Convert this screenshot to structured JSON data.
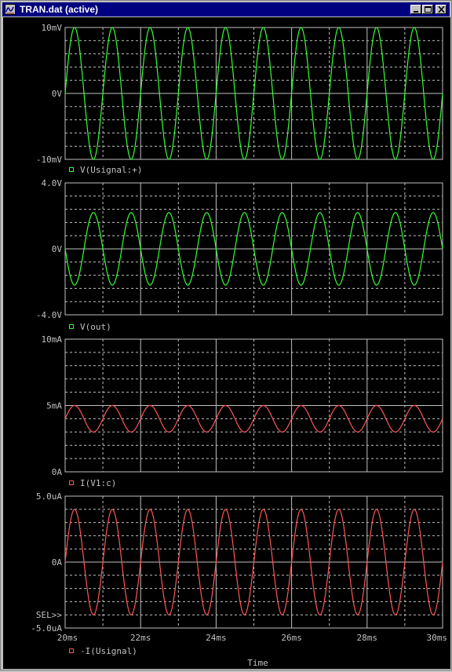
{
  "window": {
    "title": "TRAN.dat (active)",
    "buttons": [
      "minimize",
      "maximize",
      "close"
    ],
    "icon": "probe-window-icon"
  },
  "colors": {
    "background": "#000000",
    "grid": "#c0c0c0",
    "text": "#c0c0c0",
    "green_trace": "#33ff33",
    "red_trace": "#ff5555",
    "titlebar": "#000080"
  },
  "chart_data": [
    {
      "type": "line",
      "x_unit": "ms",
      "xlim": [
        20,
        30
      ],
      "ytick_labels": [
        "10mV",
        "0V",
        "-10mV"
      ],
      "ylim": [
        -10,
        10
      ],
      "y_unit": "mV",
      "grid": true,
      "series": [
        {
          "name": "V(Usignal:+)",
          "color": "#33ff33",
          "waveform": "sine",
          "frequency_khz": 1,
          "amplitude": 10,
          "offset": 0,
          "phase_deg": 0
        }
      ],
      "legend": [
        "V(Usignal:+)"
      ]
    },
    {
      "type": "line",
      "x_unit": "ms",
      "xlim": [
        20,
        30
      ],
      "ytick_labels": [
        "4.0V",
        "0V",
        "-4.0V"
      ],
      "ylim": [
        -4,
        4
      ],
      "y_unit": "V",
      "grid": true,
      "series": [
        {
          "name": "V(out)",
          "color": "#33ff33",
          "waveform": "sine",
          "frequency_khz": 1,
          "amplitude": 2.2,
          "offset": 0,
          "phase_deg": 180
        }
      ],
      "legend": [
        "V(out)"
      ]
    },
    {
      "type": "line",
      "x_unit": "ms",
      "xlim": [
        20,
        30
      ],
      "ytick_labels": [
        "10mA",
        "5mA",
        "0A"
      ],
      "ylim": [
        0,
        10
      ],
      "y_unit": "mA",
      "grid": true,
      "series": [
        {
          "name": "I(V1:c)",
          "color": "#ff5555",
          "waveform": "sine",
          "frequency_khz": 1,
          "amplitude": 1.0,
          "offset": 4.0,
          "phase_deg": 0
        }
      ],
      "legend": [
        "I(V1:c)"
      ]
    },
    {
      "type": "line",
      "x_unit": "ms",
      "xlim": [
        20,
        30
      ],
      "ytick_labels": [
        "5.0uA",
        "0A",
        "-5.0uA"
      ],
      "ylim": [
        -5,
        5
      ],
      "y_unit": "uA",
      "grid": true,
      "series": [
        {
          "name": "-I(Usignal)",
          "color": "#ff5555",
          "waveform": "sine",
          "frequency_khz": 1,
          "amplitude": 4.0,
          "offset": 0,
          "phase_deg": 0
        }
      ],
      "legend": [
        "-I(Usignal)"
      ],
      "marker_text": "SEL>>",
      "xtick_labels": [
        "20ms",
        "22ms",
        "24ms",
        "26ms",
        "28ms",
        "30ms"
      ],
      "xlabel": "Time"
    }
  ]
}
